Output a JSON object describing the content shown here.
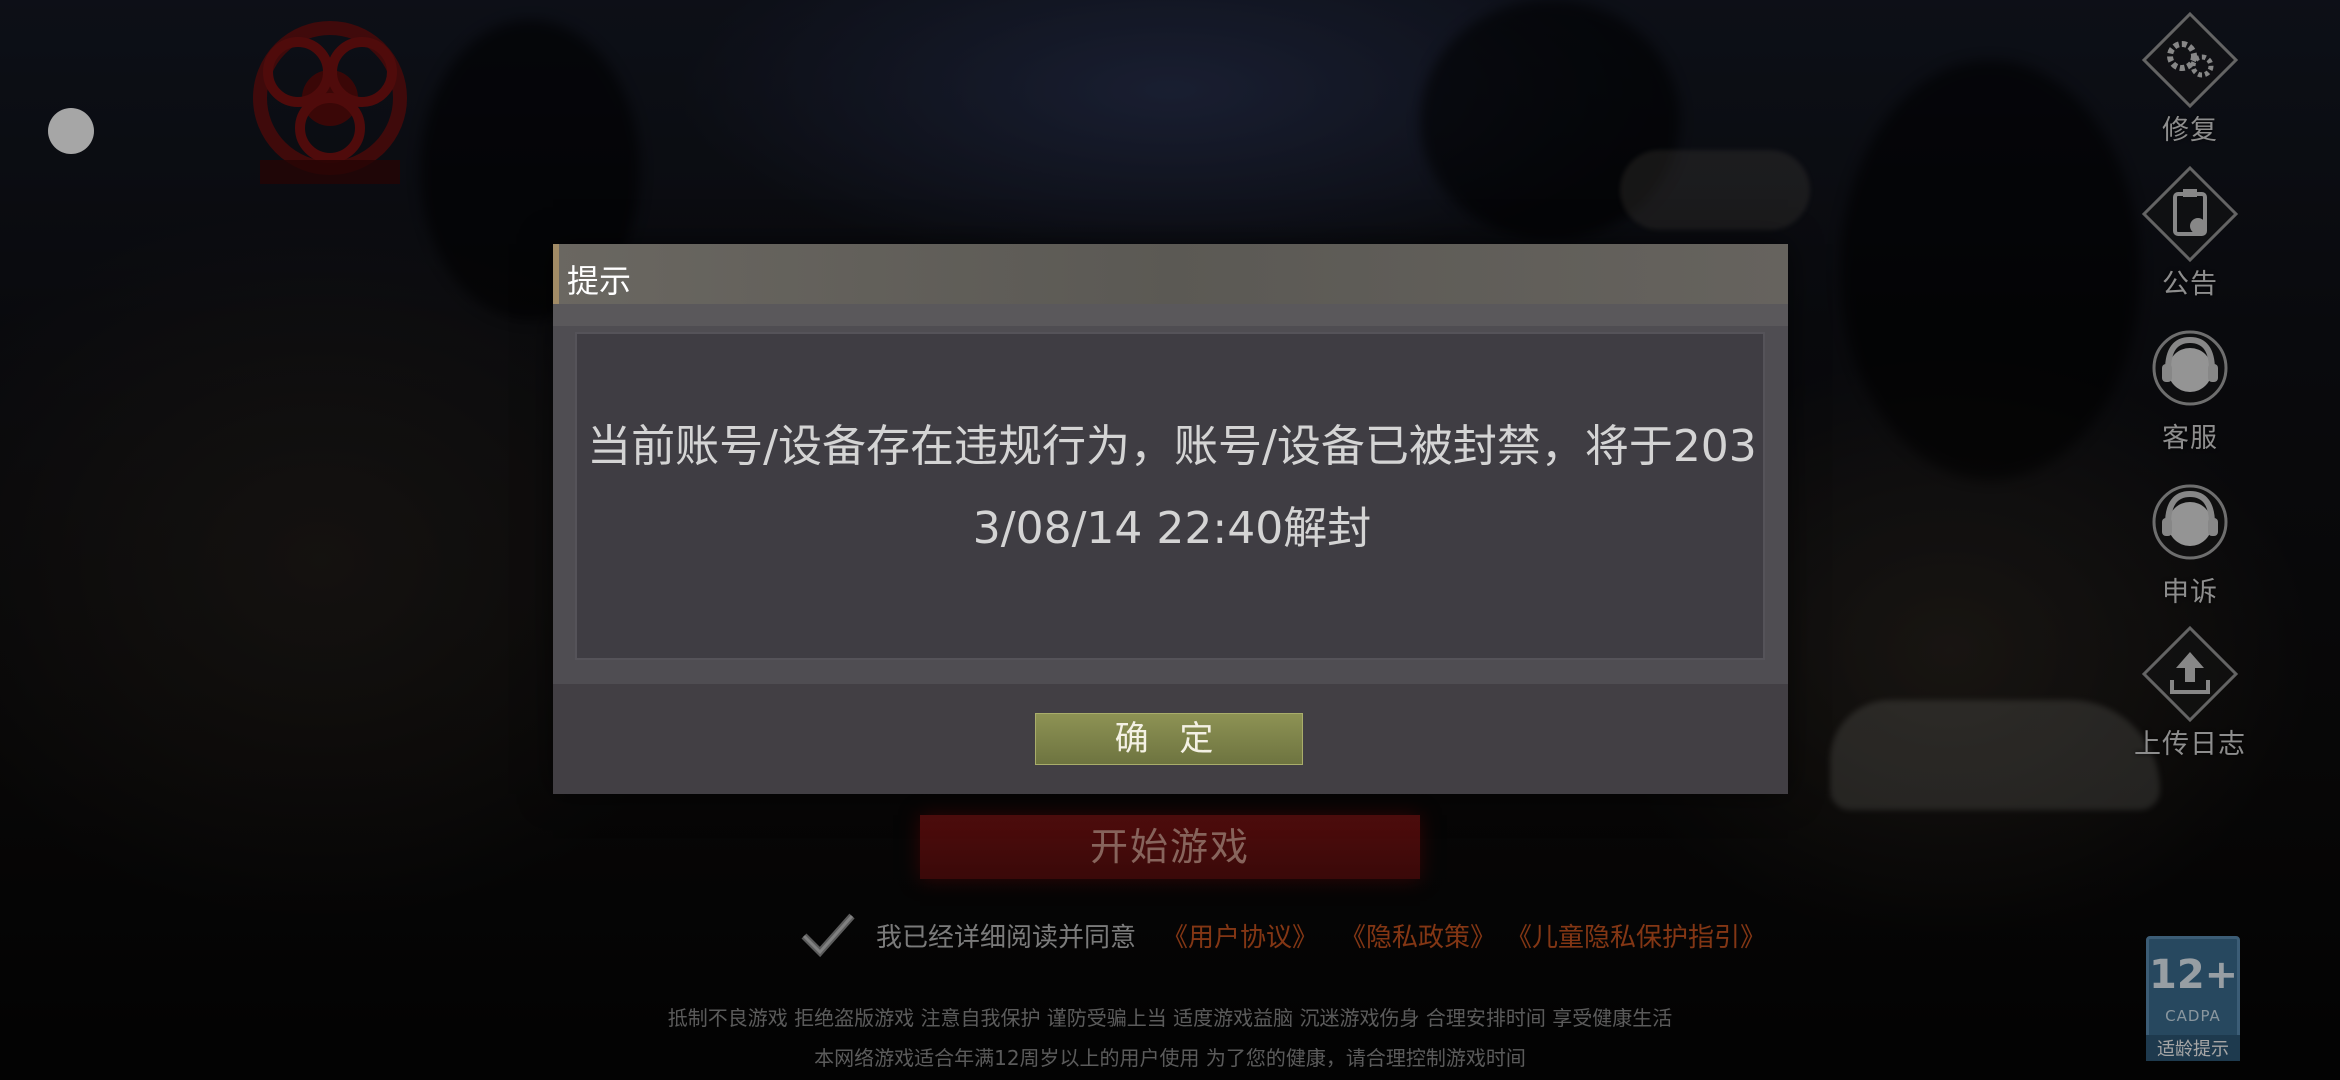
{
  "game": {
    "logo_icon": "biohazard-logo-icon"
  },
  "side_menu": [
    {
      "label": "修复",
      "icon": "gear-icon"
    },
    {
      "label": "公告",
      "icon": "clipboard-icon"
    },
    {
      "label": "客服",
      "icon": "headset-icon"
    },
    {
      "label": "申诉",
      "icon": "headset-icon"
    },
    {
      "label": "上传日志",
      "icon": "upload-icon"
    }
  ],
  "start_button": {
    "label": "开始游戏"
  },
  "agreement": {
    "text": "我已经详细阅读并同意",
    "links": [
      "《用户协议》",
      "《隐私政策》",
      "《儿童隐私保护指引》"
    ]
  },
  "notices": {
    "line1": "抵制不良游戏  拒绝盗版游戏  注意自我保护  谨防受骗上当  适度游戏益脑  沉迷游戏伤身  合理安排时间  享受健康生活",
    "line2": "本网络游戏适合年满12周岁以上的用户使用    为了您的健康，请合理控制游戏时间"
  },
  "age_rating": {
    "main": "12+",
    "sub": "CADPA",
    "tip": "适龄提示"
  },
  "dialog": {
    "title": "提示",
    "message": "当前账号/设备存在违规行为，账号/设备已被封禁，将于2033/08/14 22:40解封",
    "confirm_label": "确 定"
  },
  "colors": {
    "dialog_bg": "#4f4d52",
    "confirm_btn": "#8d9254",
    "start_btn": "#7a1414",
    "link_orange": "#c9531f"
  }
}
